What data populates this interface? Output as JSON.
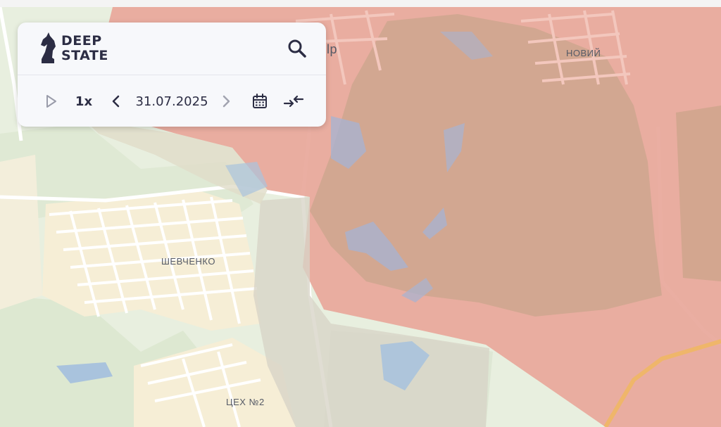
{
  "app": {
    "logo_line1": "DEEP",
    "logo_line2": "STATE"
  },
  "controls": {
    "play_icon": "play-icon",
    "speed_label": "1x",
    "prev_icon": "chevron-left-icon",
    "date": "31.07.2025",
    "next_icon": "chevron-right-icon",
    "calendar_icon": "calendar-icon",
    "compare_icon": "compare-arrows-icon",
    "search_icon": "search-icon"
  },
  "map": {
    "labels": {
      "shevchenko": "ШЕВЧЕНКО",
      "tsekh2": "ЦЕХ №2",
      "noviy": "НОВИЙ",
      "partial": "lp"
    },
    "colors": {
      "occupied": "#e8a79a",
      "occupied_forest": "#cfa58f",
      "contested": "#d9d7cc",
      "settlement": "#f6efd8",
      "field": "#e6efdc",
      "water": "#a9b5d3",
      "road": "#ffffff",
      "highway": "#efb66a"
    }
  }
}
